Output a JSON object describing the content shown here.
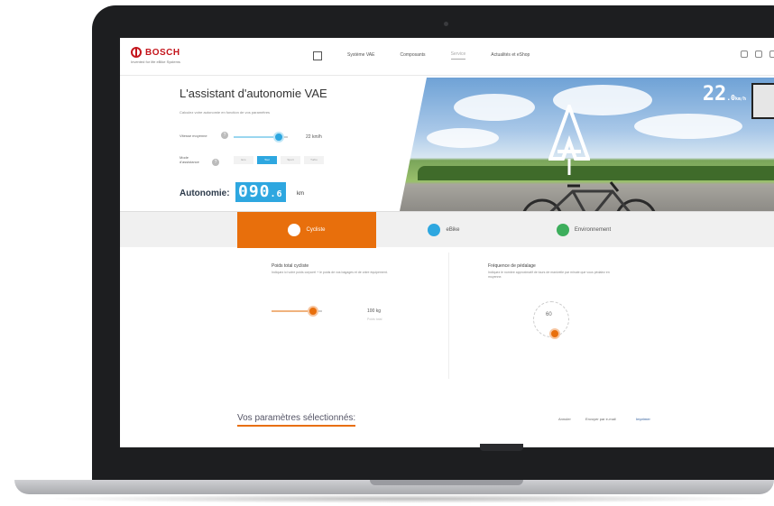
{
  "header": {
    "brand": "BOSCH",
    "brand_tagline": "Invented for life eBike Systems",
    "nav": [
      {
        "label": "Système VAE"
      },
      {
        "label": "Composants"
      },
      {
        "label": "Service"
      },
      {
        "label": "Actualités et eShop"
      }
    ],
    "active_nav_index": 2
  },
  "assistant": {
    "title": "L'assistant d'autonomie VAE",
    "subtitle": "Calculez votre autonomie en fonction de vos paramètres",
    "speed_label": "Vitesse moyenne",
    "speed_value": "22 km/h",
    "speed_fraction": 0.83,
    "mode_label": "Mode d'assistance",
    "modes": [
      "Eco",
      "Tour",
      "Sport",
      "Turbo"
    ],
    "selected_mode_index": 1,
    "autonomy_label": "Autonomie:",
    "autonomy_value": "090",
    "autonomy_decimal": ".6",
    "autonomy_unit": "km"
  },
  "hero": {
    "speed_display": "22",
    "speed_display_decimal": ".0",
    "speed_display_unit": "km/h"
  },
  "tabs": [
    {
      "label": "Cycliste",
      "color": "#e86f0c"
    },
    {
      "label": "eBike",
      "color": "#2ea7e0"
    },
    {
      "label": "Environnement",
      "color": "#3dae5c"
    }
  ],
  "active_tab_index": 0,
  "cyclist": {
    "weight_title": "Poids total cycliste",
    "weight_text": "Indiquez ici votre poids corporel + le poids de vos bagages et de votre équipement.",
    "weight_value": "100 kg",
    "weight_sub": "Poids total",
    "weight_fraction": 0.82,
    "cadence_title": "Fréquence de pédalage",
    "cadence_text": "Indiquez le nombre approximatif de tours de manivelle par minute que vous pédalez en moyenne.",
    "cadence_value": "60"
  },
  "footer": {
    "selected_params": "Vos paramètres sélectionnés:",
    "link_reset": "Annuler",
    "link_share": "Envoyer par e-mail",
    "link_print": "Imprimer"
  }
}
